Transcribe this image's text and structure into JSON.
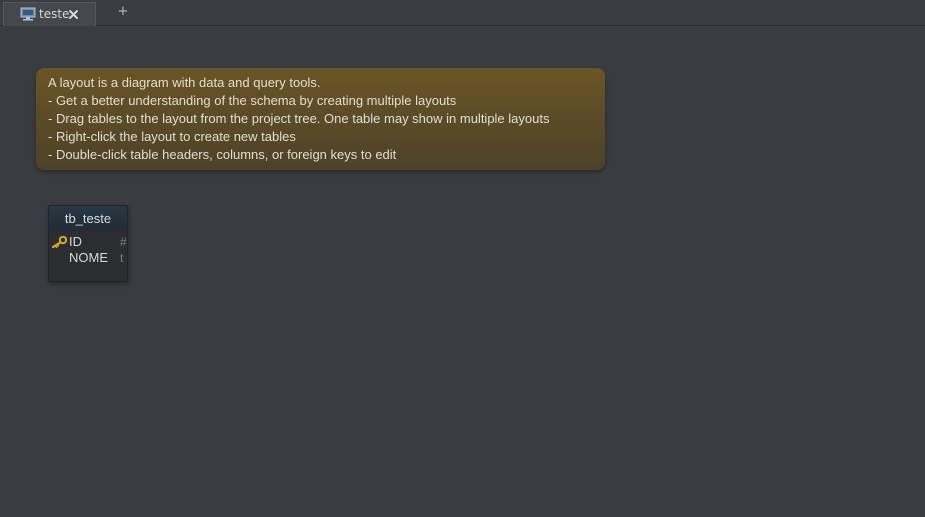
{
  "tabs": [
    {
      "label": "teste",
      "icon": "diagram-icon",
      "active": true
    }
  ],
  "add_tab_label": "+",
  "hint": {
    "lines": [
      "A layout is a diagram with data and query tools.",
      "- Get a better understanding of the schema by creating multiple layouts",
      "- Drag tables to the layout from the project tree. One table may show in multiple layouts",
      "- Right-click the layout to create new tables",
      "- Double-click table headers, columns, or foreign keys to edit"
    ]
  },
  "table": {
    "name": "tb_teste",
    "columns": [
      {
        "name": "ID",
        "type_glyph": "#",
        "primary_key": true
      },
      {
        "name": "NOME",
        "type_glyph": "t",
        "primary_key": false
      }
    ]
  },
  "colors": {
    "background": "#393c40",
    "hint_top": "#6a5424",
    "hint_bottom": "#4c4229",
    "table_header": "#273845",
    "key_icon": "#d4a829"
  }
}
